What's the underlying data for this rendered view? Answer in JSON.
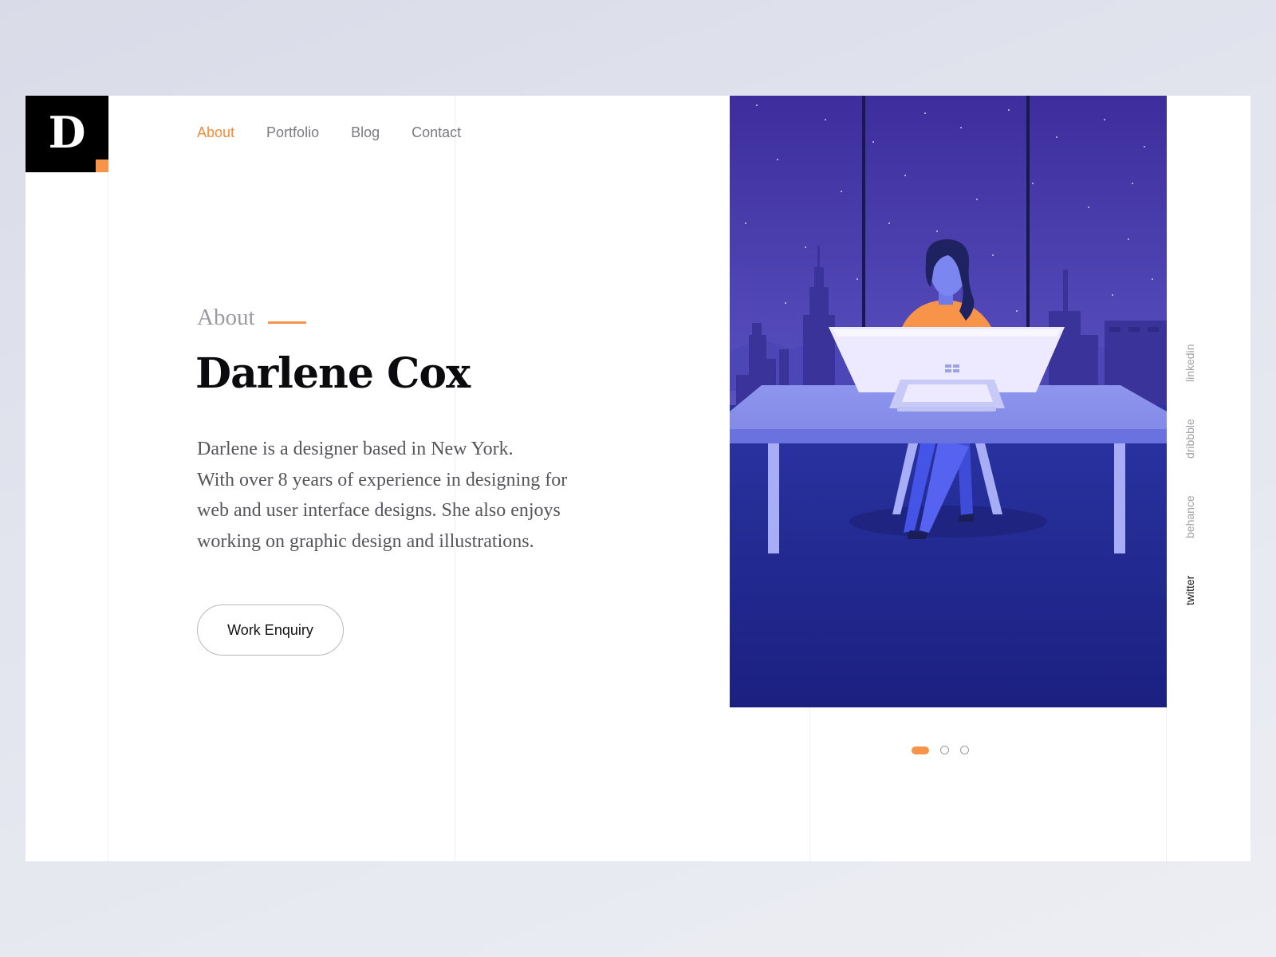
{
  "brand": {
    "logo_letter": "D"
  },
  "colors": {
    "accent": "#f7944a",
    "nav_active": "#f28b3c",
    "night_sky_top": "#3f2f9e",
    "night_sky_bottom": "#6a6fd0",
    "floor": "#232a8c"
  },
  "nav": {
    "items": [
      {
        "label": "About",
        "active": true
      },
      {
        "label": "Portfolio",
        "active": false
      },
      {
        "label": "Blog",
        "active": false
      },
      {
        "label": "Contact",
        "active": false
      }
    ]
  },
  "hero": {
    "kicker": "About",
    "name": "Darlene Cox",
    "bio_lines": [
      "Darlene is a designer based in New York.",
      "With over 8 years of experience in designing for",
      "web and user interface designs. She also enjoys",
      "working on graphic design and illustrations."
    ],
    "cta_label": "Work Enquiry"
  },
  "illustration": {
    "icon": "woman-at-desk-night-city-illustration"
  },
  "carousel": {
    "total": 3,
    "active_index": 0
  },
  "social": {
    "items": [
      {
        "label": "linkedin",
        "active": false
      },
      {
        "label": "dribbble",
        "active": false
      },
      {
        "label": "behance",
        "active": false
      },
      {
        "label": "twitter",
        "active": true
      }
    ]
  }
}
